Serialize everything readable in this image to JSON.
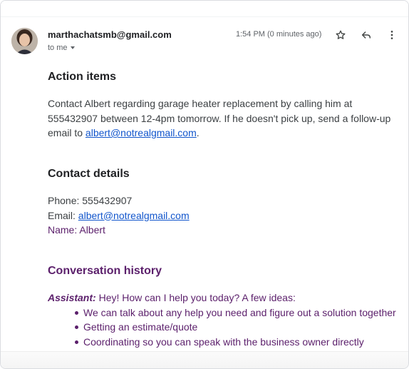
{
  "header": {
    "sender": "marthachatsmb@gmail.com",
    "to_label": "to me",
    "time": "1:54 PM (0 minutes ago)"
  },
  "sections": {
    "action_title": "Action items",
    "action_text": "Contact Albert regarding garage heater replacement by calling him at 555432907 between 12-4pm tomorrow. If he doesn't pick up, send a follow-up email to",
    "action_email": "albert@notrealgmail.com",
    "action_period": ".",
    "contact_title": "Contact details",
    "phone_label": "Phone: 555432907",
    "email_label": "Email: ",
    "email_value": "albert@notrealgmail.com",
    "name_label": "Name: Albert",
    "history_title": "Conversation history",
    "assistant_label": "Assistant:",
    "assistant_text": " Hey! How can I help you today? A few ideas:",
    "ideas": [
      "We can talk about any help you need and figure out a solution together",
      "Getting an estimate/quote",
      "Coordinating so you can speak with the business owner directly"
    ]
  },
  "icons": [
    "star-icon",
    "reply-icon",
    "more-vertical-icon",
    "chevron-down-icon"
  ]
}
